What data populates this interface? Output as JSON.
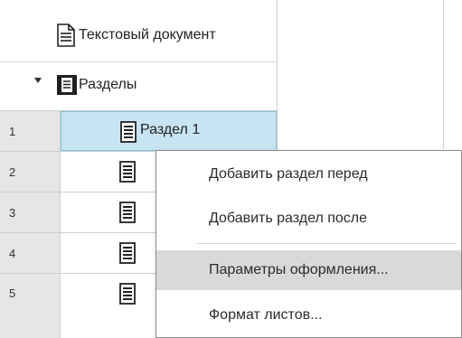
{
  "tree": {
    "document": {
      "label": "Текстовый документ",
      "icon": "document-icon"
    },
    "sections": {
      "label": "Разделы",
      "icon": "folder-document-icon",
      "expanded": true
    },
    "rows": [
      {
        "num": "1",
        "label": "Раздел 1",
        "selected": true
      },
      {
        "num": "2",
        "label": ""
      },
      {
        "num": "3",
        "label": ""
      },
      {
        "num": "4",
        "label": ""
      },
      {
        "num": "5",
        "label": ""
      }
    ]
  },
  "context_menu": {
    "items": [
      {
        "label": "Добавить раздел перед"
      },
      {
        "label": "Добавить раздел после"
      },
      {
        "label": "Параметры оформления...",
        "highlighted": true
      },
      {
        "label": "Формат листов..."
      }
    ]
  },
  "colors": {
    "selection_bg": "#c7e4f2",
    "selection_border": "#8cc3dd",
    "number_column_bg": "#e6e6e6",
    "menu_hover": "#d9d9d9"
  }
}
